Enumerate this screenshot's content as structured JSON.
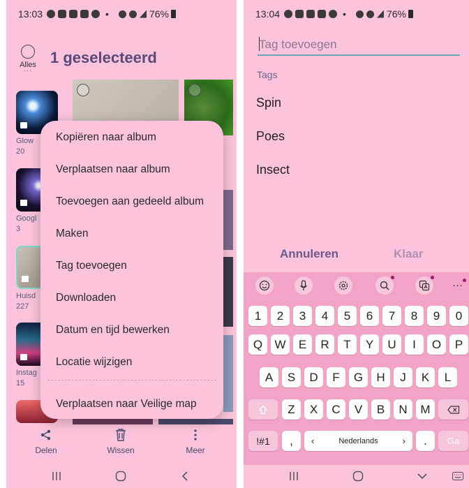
{
  "left": {
    "status": {
      "time": "13:03",
      "dot": "•",
      "battery": "76%"
    },
    "select_all_label": "Alles",
    "selection_title": "1 geselecteerd",
    "albums": [
      {
        "name": "Glow",
        "count": "20"
      },
      {
        "name": "Googl",
        "count": "3"
      },
      {
        "name": "Huisd",
        "count": "227"
      },
      {
        "name": "Instag",
        "count": "15"
      }
    ],
    "menu": [
      "Kopiëren naar album",
      "Verplaatsen naar album",
      "Toevoegen aan gedeeld album",
      "Maken",
      "Tag toevoegen",
      "Downloaden",
      "Datum en tijd bewerken",
      "Locatie wijzigen",
      "Verplaatsen naar Veilige map"
    ],
    "toolbar": {
      "share": "Delen",
      "delete": "Wissen",
      "more": "Meer"
    }
  },
  "right": {
    "status": {
      "time": "13:04",
      "dot": "•",
      "battery": "76%"
    },
    "tag_placeholder": "Tag toevoegen",
    "tags_header": "Tags",
    "tags": [
      "Spin",
      "Poes",
      "Insect"
    ],
    "cancel": "Annuleren",
    "done": "Klaar",
    "keyboard": {
      "numbers": [
        "1",
        "2",
        "3",
        "4",
        "5",
        "6",
        "7",
        "8",
        "9",
        "0"
      ],
      "row1": [
        "Q",
        "W",
        "E",
        "R",
        "T",
        "Y",
        "U",
        "I",
        "O",
        "P"
      ],
      "row2": [
        "A",
        "S",
        "D",
        "F",
        "G",
        "H",
        "J",
        "K",
        "L"
      ],
      "row3": [
        "Z",
        "X",
        "C",
        "V",
        "B",
        "N",
        "M"
      ],
      "symbols": "!#1",
      "comma": ",",
      "language": "Nederlands",
      "period": ".",
      "go": "Ga"
    }
  },
  "colors": {
    "background": "#fbc4dc",
    "keyboard": "#f2a3c6",
    "accent": "#5a4a7a"
  }
}
